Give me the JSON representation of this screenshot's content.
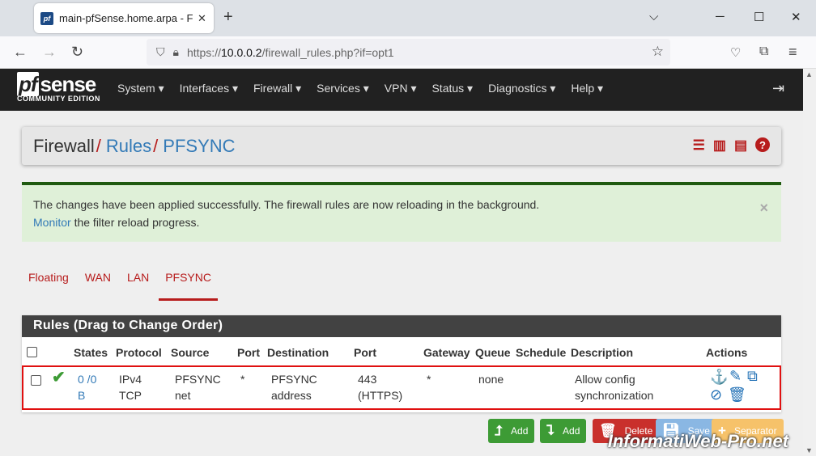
{
  "browser": {
    "tab_title": "main-pfSense.home.arpa - Fire",
    "favicon_text": "pf",
    "url_prefix": "https://",
    "url_host": "10.0.0.2",
    "url_path": "/firewall_rules.php?if=opt1"
  },
  "brand": {
    "logo_pf": "pf",
    "logo_sense": "sense",
    "edition": "COMMUNITY EDITION"
  },
  "menu": [
    "System ▾",
    "Interfaces ▾",
    "Firewall ▾",
    "Services ▾",
    "VPN ▾",
    "Status ▾",
    "Diagnostics ▾",
    "Help ▾"
  ],
  "breadcrumb": {
    "root": "Firewall",
    "level1": "Rules",
    "level2": "PFSYNC",
    "separator": "/"
  },
  "alert": {
    "line1": "The changes have been applied successfully. The firewall rules are now reloading in the background.",
    "link": "Monitor",
    "line2_rest": " the filter reload progress."
  },
  "tabs": [
    "Floating",
    "WAN",
    "LAN",
    "PFSYNC"
  ],
  "active_tab": "PFSYNC",
  "rules_panel": {
    "title": "Rules (Drag to Change Order)",
    "columns": [
      "States",
      "Protocol",
      "Source",
      "Port",
      "Destination",
      "Port",
      "Gateway",
      "Queue",
      "Schedule",
      "Description",
      "Actions"
    ],
    "rows": [
      {
        "states_1": "0 /0",
        "states_2": "B",
        "protocol_1": "IPv4",
        "protocol_2": "TCP",
        "source_1": "PFSYNC",
        "source_2": "net",
        "source_port": "*",
        "destination_1": "PFSYNC",
        "destination_2": "address",
        "dest_port_1": "443",
        "dest_port_2": "(HTTPS)",
        "gateway": "*",
        "queue": "none",
        "schedule": "",
        "description_1": "Allow config",
        "description_2": "synchronization"
      }
    ]
  },
  "buttons": {
    "add_top": "Add",
    "add_bottom": "Add",
    "delete": "Delete",
    "save": "Save",
    "separator": "Separator"
  },
  "watermark": "InformatiWeb-Pro.net",
  "colors": {
    "nav_bg": "#212121",
    "accent_red": "#b71c1c",
    "link_blue": "#337ab7",
    "success_bg": "#dff0d8",
    "highlight_box": "#e01010"
  }
}
